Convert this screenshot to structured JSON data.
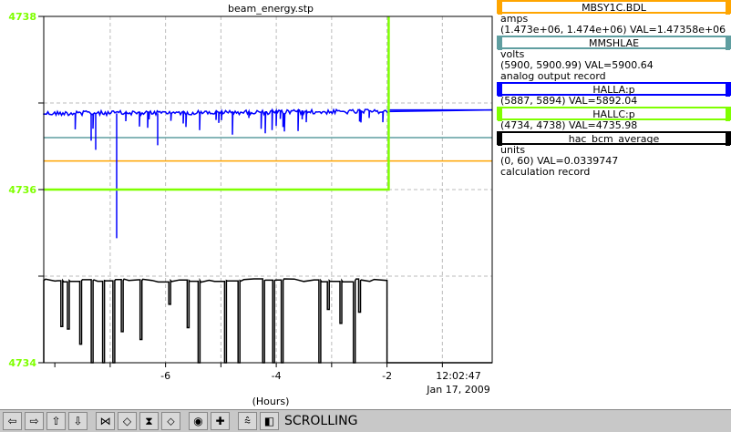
{
  "chart_data": {
    "type": "line",
    "title": "beam_energy.stp",
    "xlabel": "(Hours)",
    "x_ticks": [
      "-6",
      "-4",
      "-2"
    ],
    "xlim": [
      -8.2,
      -0.1
    ],
    "timestamp": "12:02:47",
    "date": "Jan 17, 2009",
    "y_ticks": [
      "4738",
      "4736",
      "4734"
    ],
    "ylim": [
      4734,
      4738
    ],
    "grid": true,
    "series": [
      {
        "name": "MBSY1C.BDL",
        "color": "#ffa500",
        "type": "constant",
        "y_value": 4736.33
      },
      {
        "name": "MMSHLAE",
        "color": "#5f9ea0",
        "type": "constant",
        "y_value": 4736.6
      },
      {
        "name": "HALLA:p",
        "color": "#0000ff",
        "type": "noisy-line",
        "baseline": 4736.88,
        "spike_min": 4735.3,
        "end_x": -1.97,
        "after_value": 4736.92
      },
      {
        "name": "HALLC:p",
        "color": "#7fff00",
        "type": "step",
        "before_value": 4736.0,
        "step_x": -1.97,
        "after_value": 4738.0
      },
      {
        "name": "hac_bcm_average",
        "color": "#000000",
        "type": "square-wave",
        "high": 4734.95,
        "low": 4734.0,
        "end_x": -2.0
      }
    ]
  },
  "legend": [
    {
      "name": "MBSY1C.BDL",
      "color": "#ffa500",
      "lines": [
        "amps",
        "(1.473e+06, 1.474e+06)  VAL=1.47358e+06"
      ]
    },
    {
      "name": "MMSHLAE",
      "color": "#5f9ea0",
      "lines": [
        "volts",
        "(5900, 5900.99) VAL=5900.64",
        "analog output record"
      ]
    },
    {
      "name": "HALLA:p",
      "color": "#0000ff",
      "lines": [
        "(5887, 5894) VAL=5892.04"
      ]
    },
    {
      "name": "HALLC:p",
      "color": "#7fff00",
      "lines": [
        "(4734, 4738) VAL=4735.98"
      ]
    },
    {
      "name": "hac_bcm_average",
      "color": "#000000",
      "lines": [
        "units",
        "(0, 60) VAL=0.0339747",
        "calculation record"
      ]
    }
  ],
  "toolbar": {
    "buttons": [
      {
        "name": "scroll-left-button",
        "glyph": "⇦"
      },
      {
        "name": "scroll-right-button",
        "glyph": "⇨"
      },
      {
        "name": "scroll-up-button",
        "glyph": "⇧"
      },
      {
        "name": "scroll-down-button",
        "glyph": "⇩"
      },
      {
        "name": "zoom-in-x-button",
        "glyph": "⋈"
      },
      {
        "name": "zoom-out-x-button",
        "glyph": "◇"
      },
      {
        "name": "zoom-in-y-button",
        "glyph": "⧗"
      },
      {
        "name": "zoom-out-y-button",
        "glyph": "⬦"
      },
      {
        "name": "record-button",
        "glyph": "◉"
      },
      {
        "name": "add-button",
        "glyph": "✚"
      },
      {
        "name": "auto-scale-button",
        "glyph": "⩯"
      },
      {
        "name": "cursor-button",
        "glyph": "◧"
      }
    ],
    "status": "SCROLLING"
  }
}
